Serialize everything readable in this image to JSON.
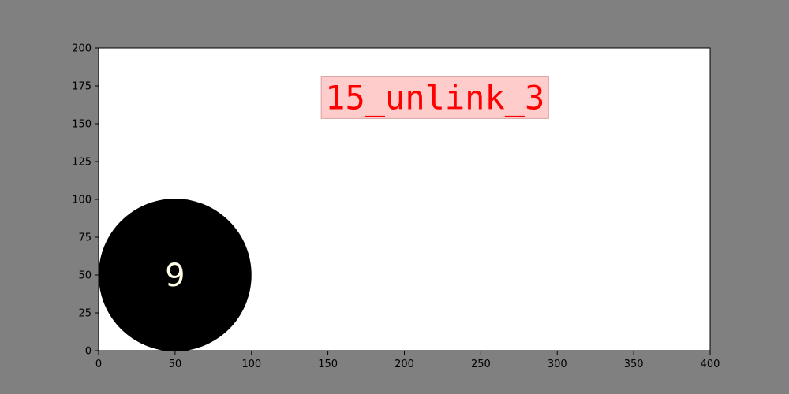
{
  "colors": {
    "figure_bg": "#808080",
    "axes_bg": "#ffffff",
    "node_fill": "#000000",
    "node_text": "#fffde6",
    "annotation_text": "#ff0000",
    "annotation_bg": "#ffcccc",
    "annotation_border": "#d9a0a0"
  },
  "chart_data": {
    "type": "scatter",
    "title": "",
    "xlabel": "",
    "ylabel": "",
    "xlim": [
      0,
      400
    ],
    "ylim": [
      0,
      200
    ],
    "grid": false,
    "x_ticks": [
      "0",
      "50",
      "100",
      "150",
      "200",
      "250",
      "300",
      "350",
      "400"
    ],
    "y_ticks": [
      "0",
      "25",
      "50",
      "75",
      "100",
      "125",
      "150",
      "175",
      "200"
    ],
    "nodes": [
      {
        "label": "9",
        "x": 50,
        "y": 50,
        "radius": 50
      }
    ],
    "annotations": [
      {
        "text": "15_unlink_3",
        "x": 220,
        "y": 167
      }
    ]
  }
}
